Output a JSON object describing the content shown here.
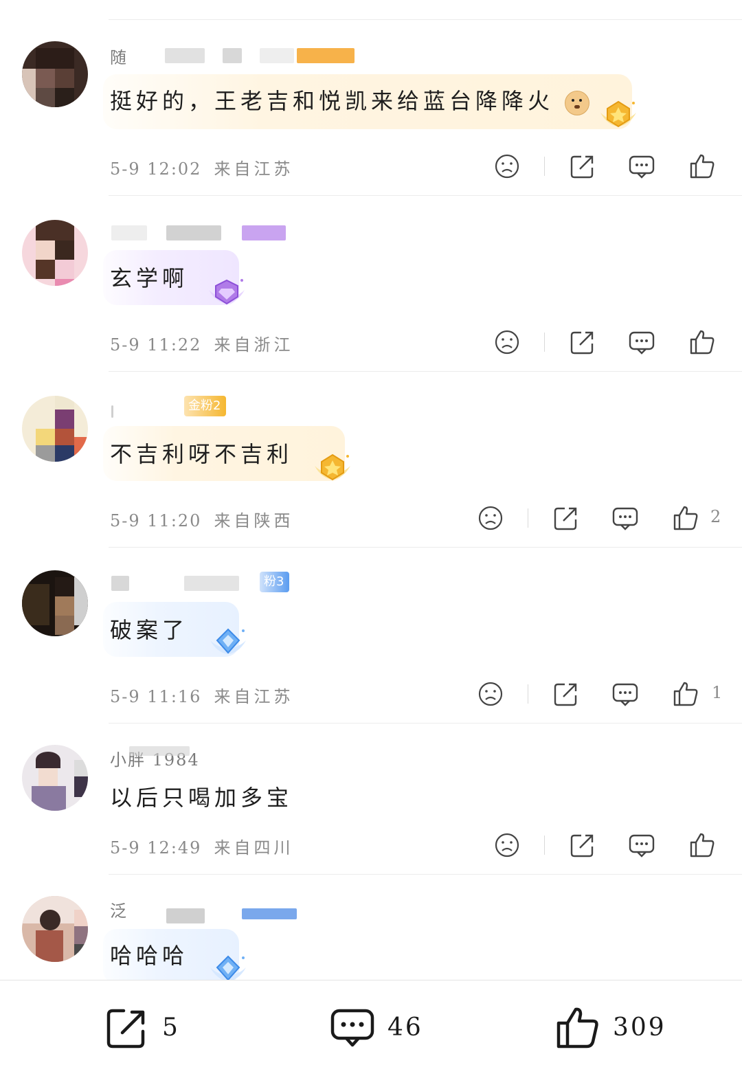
{
  "comments": [
    {
      "name": "随",
      "text": "挺好的，王老吉和悦凯来给蓝台降降火",
      "emoji": "doge-emoji",
      "time": "5-9 12:02",
      "location": "来自江苏",
      "likes": "",
      "medal": "gold"
    },
    {
      "name": "",
      "text": "玄学啊",
      "time": "5-9 11:22",
      "location": "来自浙江",
      "likes": "",
      "medal": "purple"
    },
    {
      "name": "",
      "badge": "金粉2",
      "text": "不吉利呀不吉利",
      "time": "5-9 11:20",
      "location": "来自陕西",
      "likes": "2",
      "medal": "gold"
    },
    {
      "name": "",
      "badge": "粉3",
      "text": "破案了",
      "time": "5-9 11:16",
      "location": "来自江苏",
      "likes": "1",
      "medal": "blue"
    },
    {
      "name": "小胖 1984",
      "text": "以后只喝加多宝",
      "time": "5-9 12:49",
      "location": "来自四川",
      "likes": ""
    },
    {
      "name": "泛",
      "text": "哈哈哈",
      "medal": "blue"
    }
  ],
  "bottom_bar": {
    "share_count": "5",
    "comment_count": "46",
    "like_count": "309"
  },
  "colors": {
    "gold_badge": "#f5b731",
    "blue_badge": "#5b9cf0",
    "purple_tag": "#c9a4f0",
    "meta_text": "#8a8a8a"
  }
}
